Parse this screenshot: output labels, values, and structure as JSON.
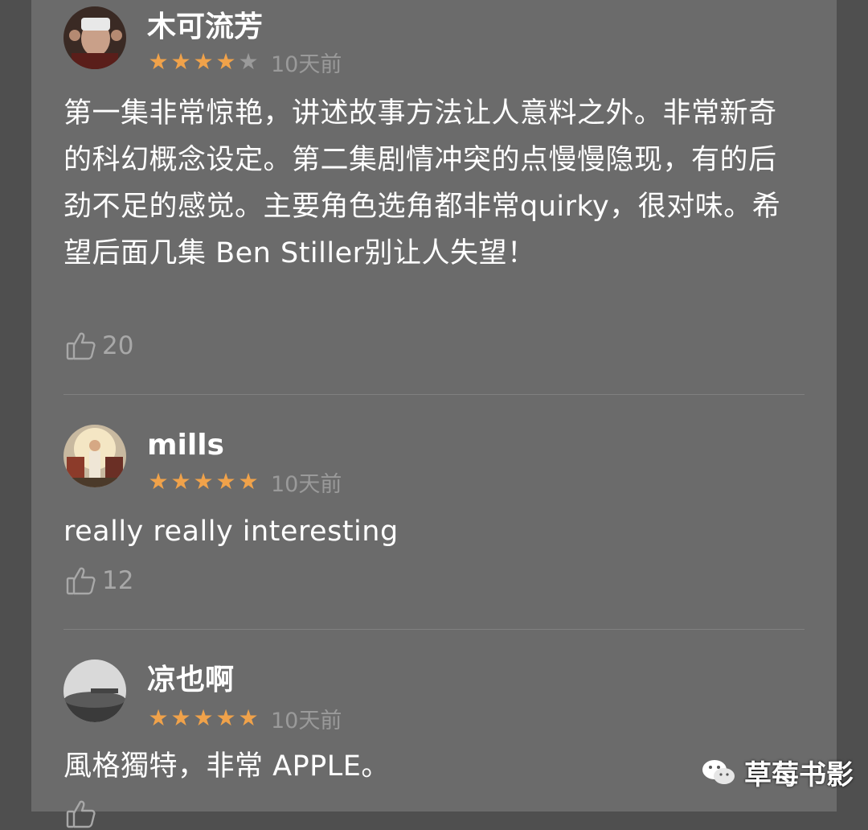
{
  "reviews": [
    {
      "user": "木可流芳",
      "stars": 4,
      "time": "10天前",
      "text": "第一集非常惊艳，讲述故事方法让人意料之外。非常新奇的科幻概念设定。第二集剧情冲突的点慢慢隐现，有的后劲不足的感觉。主要角色选角都非常quirky，很对味。希望后面几集 Ben Stiller别让人失望！",
      "likes": "20"
    },
    {
      "user": "mills",
      "stars": 5,
      "time": "10天前",
      "text": "really really interesting",
      "likes": "12"
    },
    {
      "user": "凉也啊",
      "stars": 5,
      "time": "10天前",
      "text": "風格獨特，非常 APPLE。",
      "likes": ""
    }
  ],
  "watermark": "草莓书影",
  "colors": {
    "star": "#f0a24a",
    "panel": "#6b6b6b",
    "background": "#4f4f4f"
  },
  "icons": {
    "like": "thumbs-up-icon",
    "star": "star-icon",
    "watermark": "wechat-icon"
  }
}
